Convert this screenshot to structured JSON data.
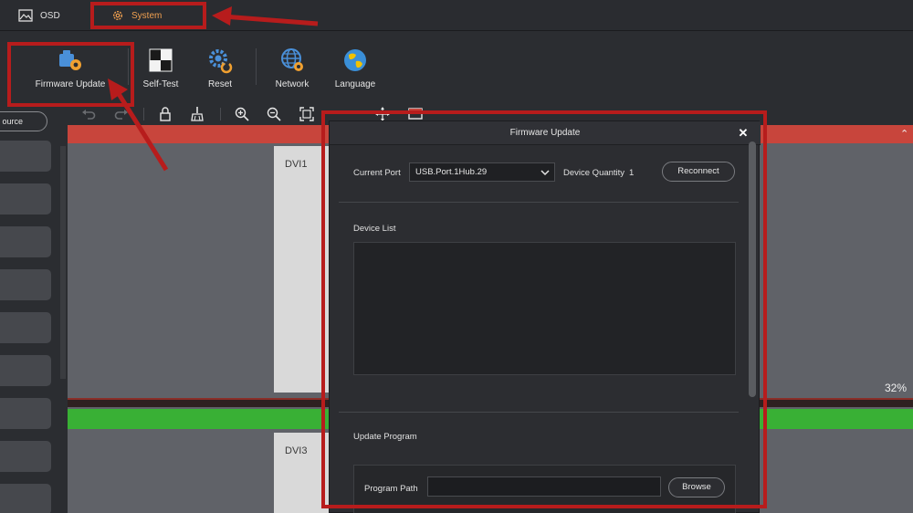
{
  "tabs": {
    "osd": "OSD",
    "system": "System"
  },
  "toolbar": {
    "firmware_update": "Firmware Update",
    "self_test": "Self-Test",
    "reset": "Reset",
    "network": "Network",
    "language": "Language"
  },
  "left": {
    "source_label": "ource"
  },
  "canvas": {
    "dvi1": "DVI1",
    "dvi3": "DVI3",
    "zoom": "32%"
  },
  "dialog": {
    "title": "Firmware Update",
    "current_port_label": "Current Port",
    "current_port_value": "USB.Port.1Hub.29",
    "device_quantity_label": "Device Quantity",
    "device_quantity_value": "1",
    "reconnect": "Reconnect",
    "device_list_label": "Device List",
    "update_program_label": "Update Program",
    "program_path_label": "Program Path",
    "browse": "Browse"
  },
  "colors": {
    "accent": "#f0a050",
    "annotation": "#b71c1c",
    "red_bar": "#c8453c",
    "green_bar": "#39b035"
  }
}
